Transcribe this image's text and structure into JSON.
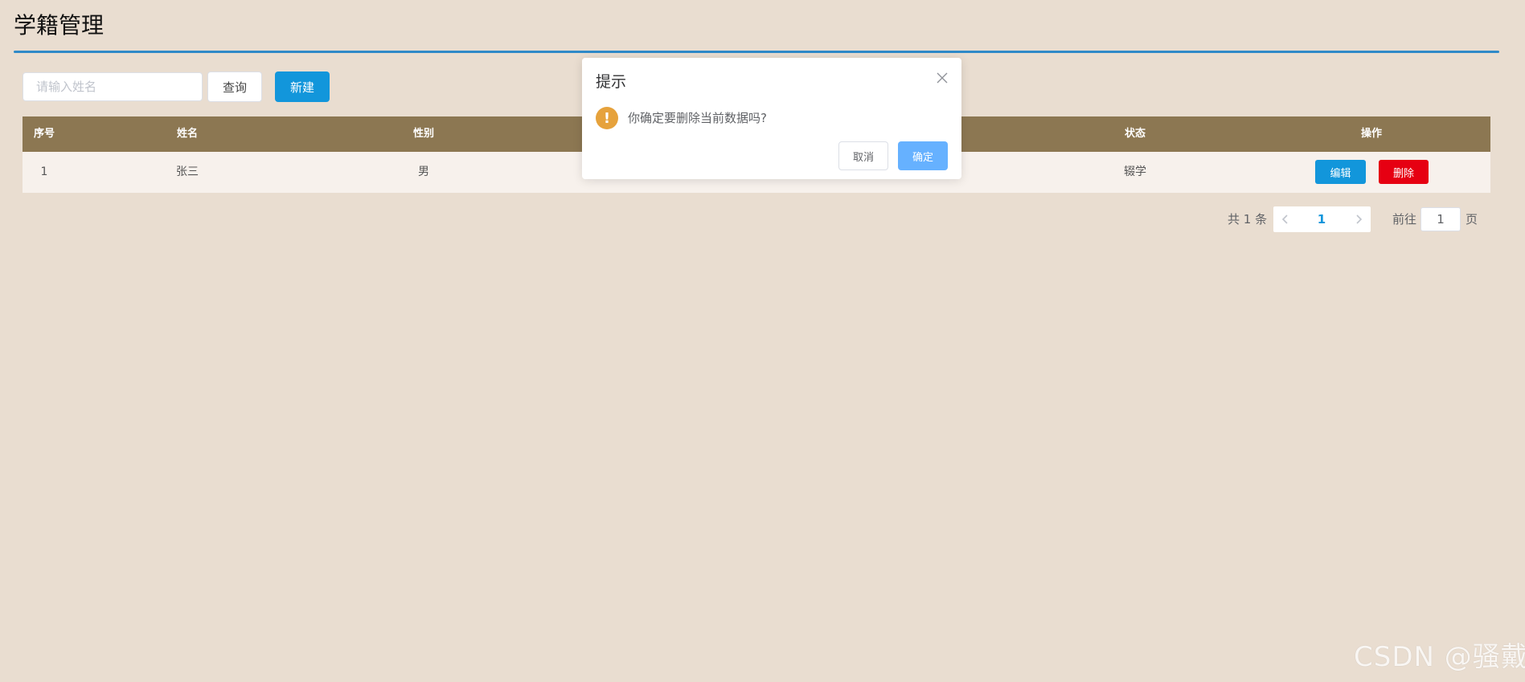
{
  "page": {
    "title": "学籍管理"
  },
  "toolbar": {
    "search_placeholder": "请输入姓名",
    "search_value": "",
    "query_label": "查询",
    "new_label": "新建"
  },
  "table": {
    "columns": [
      "序号",
      "姓名",
      "性别",
      "状态",
      "操作"
    ],
    "rows": [
      {
        "index": "1",
        "name": "张三",
        "gender": "男",
        "status": "辍学",
        "edit_label": "编辑",
        "delete_label": "删除"
      }
    ]
  },
  "pagination": {
    "total_text": "共 1 条",
    "prev_icon": "chevron-left-icon",
    "current_page": "1",
    "next_icon": "chevron-right-icon",
    "goto_label": "前往",
    "goto_value": "1",
    "unit_label": "页"
  },
  "dialog": {
    "title": "提示",
    "message": "你确定要删除当前数据吗?",
    "cancel_label": "取消",
    "confirm_label": "确定",
    "icon": "warning-icon",
    "warning_glyph": "!"
  },
  "watermark": {
    "text": "CSDN @骚戴"
  },
  "colors": {
    "background": "#e9ddd0",
    "accent_rule": "#2f8ac8",
    "table_header": "#8c7752",
    "primary": "#1296db",
    "danger": "#e60012",
    "warning": "#e6a23c",
    "confirm_light": "#66b1ff"
  }
}
